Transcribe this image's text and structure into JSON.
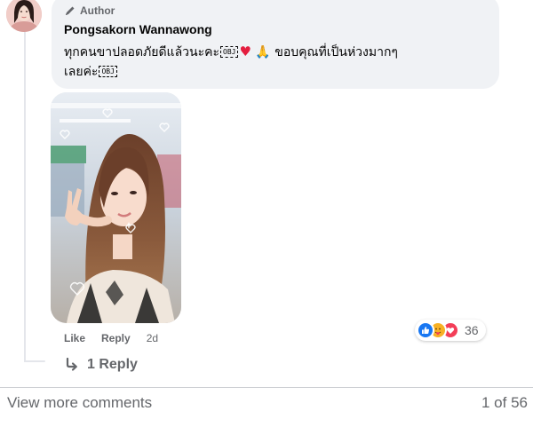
{
  "comment": {
    "author_badge": "Author",
    "commenter_name": "Pongsakorn Wannawong",
    "text_line1_part1": "ทุกคนขาปลอดภัยดีแล้วนะคะ",
    "text_line1_part2": "ขอบคุณที่เป็นห่วงมากๆ",
    "text_line2": "เลยค่ะ",
    "obj_glyph": "OBJ",
    "heart_emoji": "♥",
    "pray_emoji": "🙏"
  },
  "actions": {
    "like_label": "Like",
    "reply_label": "Reply",
    "timestamp": "2d"
  },
  "reactions": {
    "types": [
      "like",
      "care",
      "love"
    ],
    "count": "36"
  },
  "replies": {
    "label": "1 Reply"
  },
  "footer": {
    "view_more_label": "View more comments",
    "pagination": "1 of 56"
  },
  "colors": {
    "bubble_bg": "#f0f2f5",
    "secondary_text": "#65676b",
    "like_blue": "#1877f2",
    "care_yellow": "#f7b125",
    "love_red": "#f33e58"
  },
  "icons": {
    "author": "pen-icon",
    "reply_arrow": "reply-arrow-icon"
  }
}
